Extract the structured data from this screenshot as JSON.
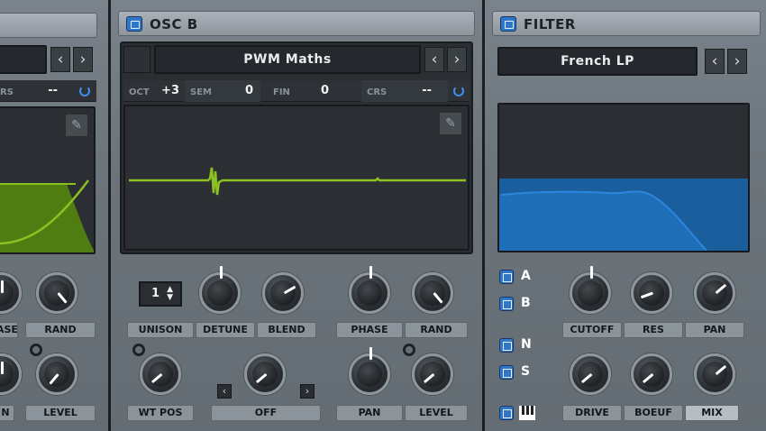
{
  "osc_a": {
    "crs_label": "RS",
    "crs_value": "--",
    "knob_labels_row1": [
      "ASE",
      "RAND"
    ],
    "knob_labels_row2": [
      "N",
      "LEVEL"
    ]
  },
  "osc_b": {
    "title": "OSC B",
    "wavetable": "PWM Maths",
    "params": {
      "oct_label": "OCT",
      "oct_value": "+3",
      "sem_label": "SEM",
      "sem_value": "0",
      "fin_label": "FIN",
      "fin_value": "0",
      "crs_label": "CRS",
      "crs_value": "--"
    },
    "unison_value": "1",
    "labels": {
      "unison": "UNISON",
      "detune": "DETUNE",
      "blend": "BLEND",
      "phase": "PHASE",
      "rand": "RAND",
      "wt_pos": "WT POS",
      "off": "OFF",
      "pan": "PAN",
      "level": "LEVEL"
    },
    "arrow_left": "‹",
    "arrow_right": "›"
  },
  "filter": {
    "title": "FILTER",
    "type": "French LP",
    "routing": [
      "A",
      "B",
      "N",
      "S"
    ],
    "labels": {
      "cutoff": "CUTOFF",
      "res": "RES",
      "pan": "PAN",
      "drive": "DRIVE",
      "boeuf": "BOEUF",
      "mix": "MIX"
    }
  },
  "colors": {
    "accent_blue": "#2f76c8",
    "waveform_green": "#8bc21f",
    "filter_blue": "#1f6fb8"
  },
  "icons": {
    "pencil": "pencil-icon",
    "power": "power-icon",
    "loop": "loop-icon",
    "keyboard": "keyboard-icon"
  }
}
